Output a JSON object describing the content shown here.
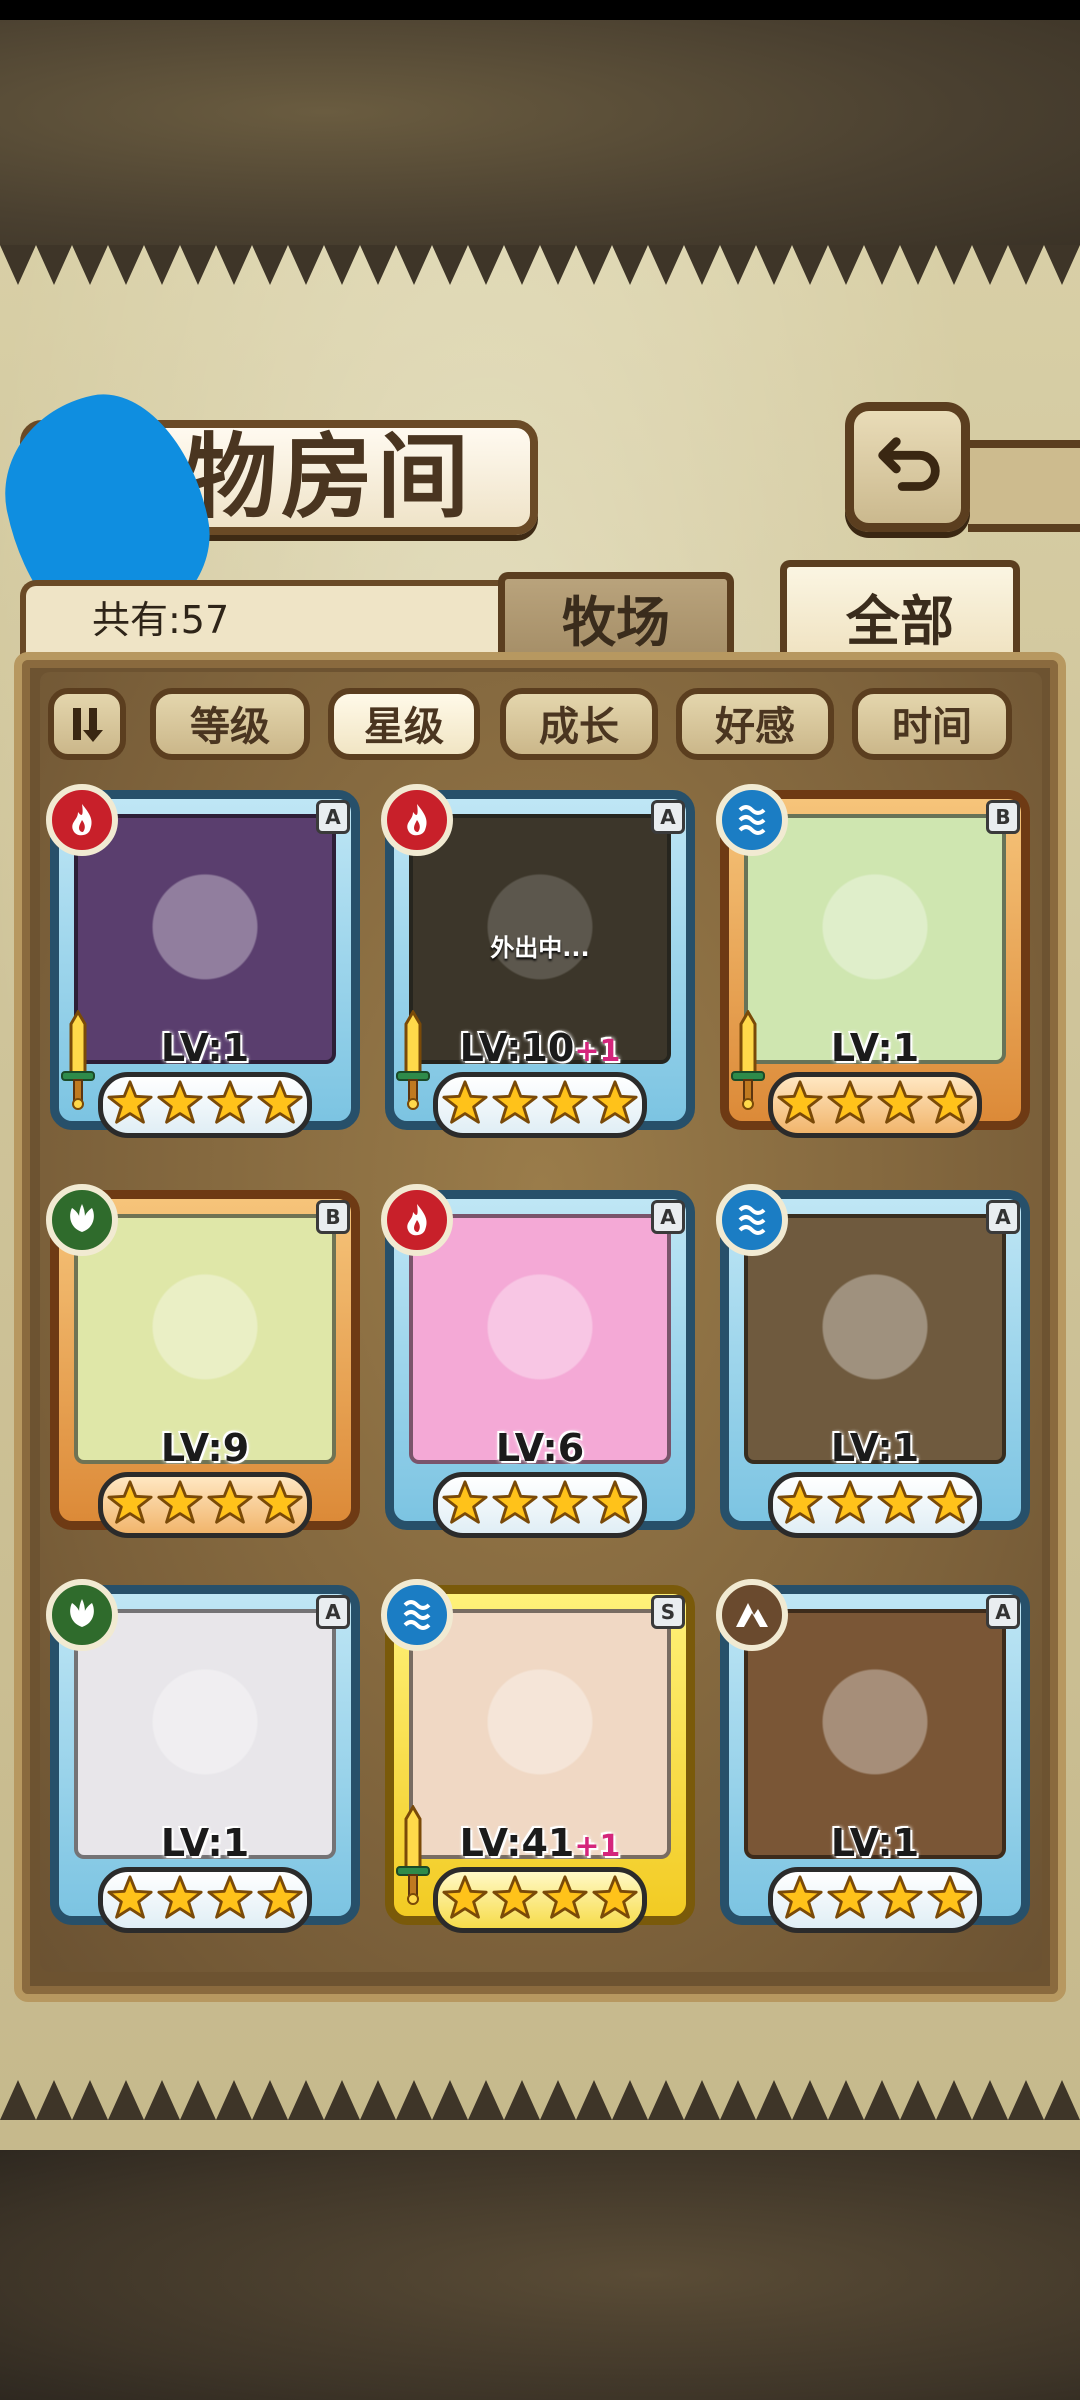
{
  "header": {
    "title": "物房间",
    "count_label": "共有:57",
    "back_icon": "return-icon"
  },
  "tabs": {
    "ranch": "牧场",
    "all": "全部"
  },
  "sort": {
    "toggle_icon": "sort-toggle-icon",
    "options": [
      "等级",
      "星级",
      "成长",
      "好感",
      "时间"
    ],
    "active": "星级"
  },
  "cards": [
    {
      "element": "fire",
      "rank": "A",
      "level": "LV:1",
      "bonus": "",
      "stars": 4,
      "weapon": true,
      "away": "",
      "frame": "blue",
      "bg": "#5a3e6e"
    },
    {
      "element": "fire",
      "rank": "A",
      "level": "LV:10",
      "bonus": "+1",
      "stars": 4,
      "weapon": true,
      "away": "外出中...",
      "frame": "blue",
      "bg": "#4d4a3c"
    },
    {
      "element": "water",
      "rank": "B",
      "level": "LV:1",
      "bonus": "",
      "stars": 4,
      "weapon": true,
      "away": "",
      "frame": "orange",
      "bg": "#cfe6b0"
    },
    {
      "element": "wood",
      "rank": "B",
      "level": "LV:9",
      "bonus": "",
      "stars": 4,
      "weapon": false,
      "away": "",
      "frame": "orange",
      "bg": "#dfe7a8"
    },
    {
      "element": "fire",
      "rank": "A",
      "level": "LV:6",
      "bonus": "",
      "stars": 4,
      "weapon": false,
      "away": "",
      "frame": "blue",
      "bg": "#f4a9d6"
    },
    {
      "element": "water",
      "rank": "A",
      "level": "LV:1",
      "bonus": "",
      "stars": 4,
      "weapon": false,
      "away": "",
      "frame": "blue",
      "bg": "#6f5a3e"
    },
    {
      "element": "wood",
      "rank": "A",
      "level": "LV:1",
      "bonus": "",
      "stars": 4,
      "weapon": false,
      "away": "",
      "frame": "blue",
      "bg": "#e8e6ea"
    },
    {
      "element": "water",
      "rank": "S",
      "level": "LV:41",
      "bonus": "+1",
      "stars": 4,
      "weapon": true,
      "away": "",
      "frame": "gold",
      "bg": "#f0d8c4"
    },
    {
      "element": "earth",
      "rank": "A",
      "level": "LV:1",
      "bonus": "",
      "stars": 4,
      "weapon": false,
      "away": "",
      "frame": "blue",
      "bg": "#7a5636"
    }
  ]
}
